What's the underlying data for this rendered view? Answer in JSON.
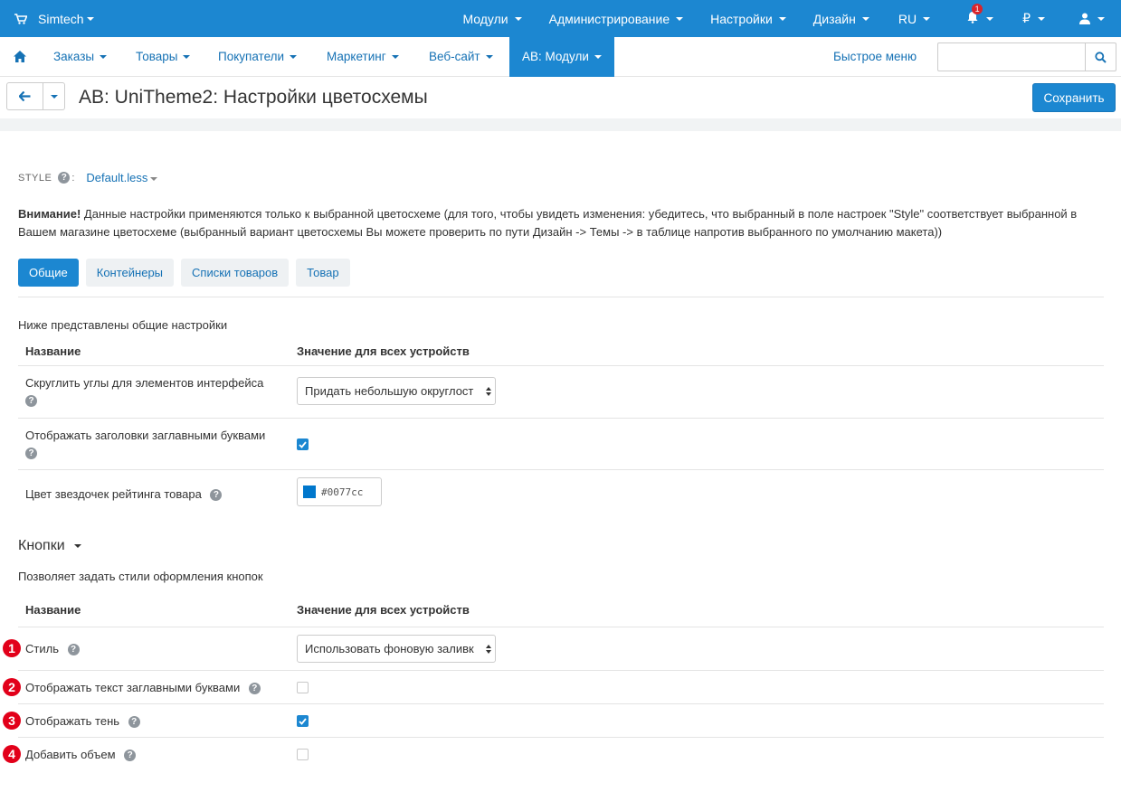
{
  "topbar": {
    "brand": "Simtech",
    "menu": [
      "Модули",
      "Администрирование",
      "Настройки",
      "Дизайн",
      "RU"
    ],
    "notifications_count": "1",
    "currency": "₽"
  },
  "nav": {
    "items": [
      "Заказы",
      "Товары",
      "Покупатели",
      "Маркетинг",
      "Веб-сайт",
      "AB: Модули"
    ],
    "quick_menu": "Быстрое меню",
    "search_placeholder": ""
  },
  "header": {
    "title": "AB: UniTheme2: Настройки цветосхемы",
    "save_label": "Сохранить"
  },
  "style": {
    "label": "STYLE",
    "colon": ":",
    "value": "Default.less"
  },
  "warning": {
    "bold": "Внимание!",
    "text": " Данные настройки применяются только к выбранной цветосхеме (для того, чтобы увидеть изменения: убедитесь, что выбранный в поле настроек \"Style\" соответствует выбранной в Вашем магазине цветосхеме (выбранный вариант цветосхемы Вы можете проверить по пути Дизайн -> Темы -> в таблице напротив выбранного по умолчанию макета))"
  },
  "tabs": [
    "Общие",
    "Контейнеры",
    "Списки товаров",
    "Товар"
  ],
  "general": {
    "description": "Ниже представлены общие настройки",
    "col_name": "Название",
    "col_value": "Значение для всех устройств",
    "rows": [
      {
        "name": "Скруглить углы для элементов интерфейса",
        "value": "Придать небольшую округлост"
      },
      {
        "name": "Отображать заголовки заглавными буквами",
        "checked": true
      },
      {
        "name": "Цвет звездочек рейтинга товара",
        "value": "#0077cc"
      }
    ]
  },
  "buttons": {
    "heading": "Кнопки",
    "description": "Позволяет задать стили оформления кнопок",
    "col_name": "Название",
    "col_value": "Значение для всех устройств",
    "rows": [
      {
        "marker": "1",
        "name": "Стиль",
        "value": "Использовать фоновую заливк"
      },
      {
        "marker": "2",
        "name": "Отображать текст заглавными буквами",
        "checked": false
      },
      {
        "marker": "3",
        "name": "Отображать тень",
        "checked": true
      },
      {
        "marker": "4",
        "name": "Добавить объем",
        "checked": false
      }
    ]
  },
  "colors": {
    "primary": "#1c87d1",
    "link": "#1672b5",
    "marker": "#e2001a",
    "star_color": "#0077cc"
  }
}
